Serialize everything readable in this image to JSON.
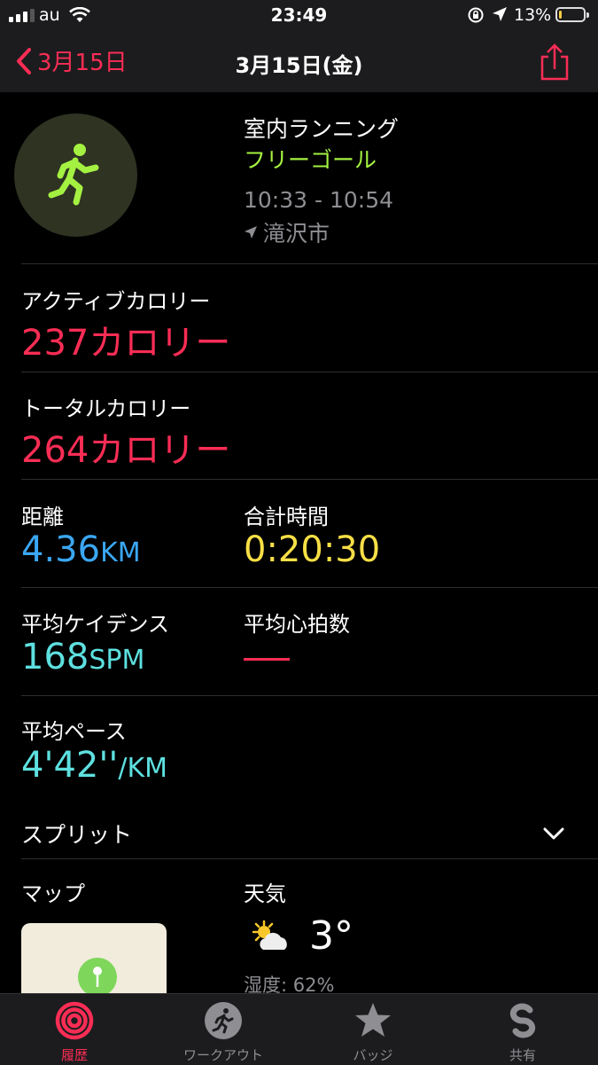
{
  "status": {
    "carrier": "au",
    "time": "23:49",
    "battery_percent": "13%",
    "battery_level": 0.13
  },
  "nav": {
    "back_label": "3月15日",
    "title": "3月15日(金)"
  },
  "workout": {
    "type": "室内ランニング",
    "goal": "フリーゴール",
    "time_range": "10:33 - 10:54",
    "location": "滝沢市"
  },
  "metrics": {
    "active_calories": {
      "label": "アクティブカロリー",
      "value": "237カロリー"
    },
    "total_calories": {
      "label": "トータルカロリー",
      "value": "264カロリー"
    },
    "distance": {
      "label": "距離",
      "value": "4.36",
      "unit": "KM"
    },
    "total_time": {
      "label": "合計時間",
      "value": "0:20:30"
    },
    "avg_cadence": {
      "label": "平均ケイデンス",
      "value": "168",
      "unit": "SPM"
    },
    "avg_heart_rate": {
      "label": "平均心拍数",
      "value": ""
    },
    "avg_pace": {
      "label": "平均ペース",
      "value": "4'42''",
      "unit": "/KM"
    }
  },
  "splits": {
    "label": "スプリット"
  },
  "map": {
    "label": "マップ"
  },
  "weather": {
    "label": "天気",
    "temperature": "3°",
    "humidity": "湿度: 62%"
  },
  "tabs": [
    {
      "label": "履歴",
      "icon": "activity-rings-icon",
      "active": true
    },
    {
      "label": "ワークアウト",
      "icon": "runner-icon",
      "active": false
    },
    {
      "label": "バッジ",
      "icon": "badge-icon",
      "active": false
    },
    {
      "label": "共有",
      "icon": "sharing-icon",
      "active": false
    }
  ],
  "colors": {
    "accent_red": "#fa2d55",
    "goal_green": "#a4f141",
    "distance_blue": "#3ba7f4",
    "time_yellow": "#f8df46",
    "pace_cyan": "#5ee0e0"
  }
}
